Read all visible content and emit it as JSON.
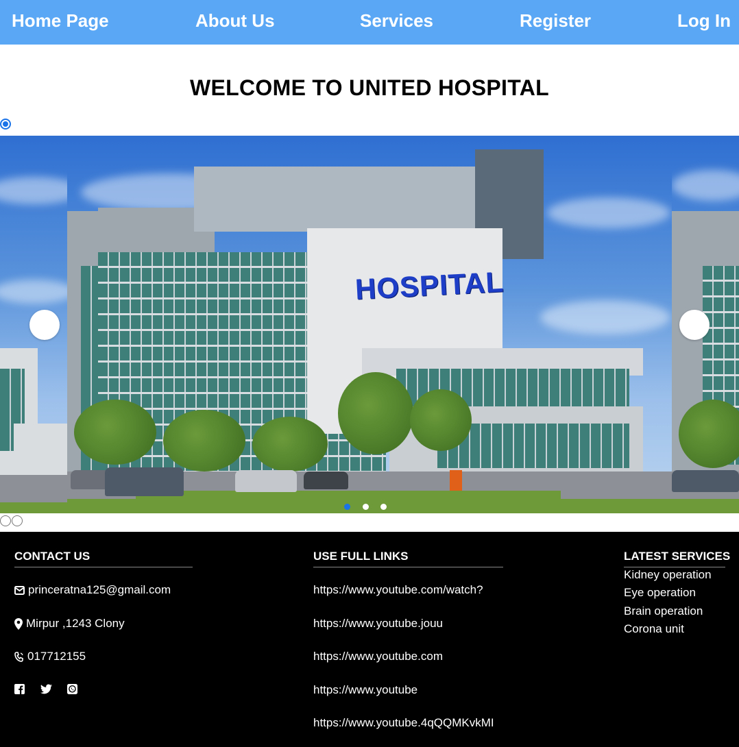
{
  "nav": {
    "items": [
      "Home Page",
      "About Us",
      "Services",
      "Register",
      "Log In"
    ]
  },
  "welcome_title": "WELCOME TO UNITED HOSPITAL",
  "slider": {
    "sign_text": "HOSPITAL",
    "slide_count": 3,
    "active_slide": 1
  },
  "footer": {
    "contact": {
      "heading": "CONTACT US",
      "email": "princeratna125@gmail.com",
      "address": "Mirpur ,1243 Clony",
      "phone": "017712155",
      "social": [
        "facebook-icon",
        "twitter-icon",
        "whatsapp-icon"
      ]
    },
    "links": {
      "heading": "USE FULL LINKS",
      "items": [
        "https://www.youtube.com/watch?",
        "https://www.youtube.jouu",
        "https://www.youtube.com",
        "https://www.youtube",
        "https://www.youtube.4qQQMKvkMI"
      ]
    },
    "services": {
      "heading": "LATEST SERVICES",
      "items": [
        "Kidney operation",
        "Eye operation",
        "Brain operation",
        "Corona unit"
      ]
    }
  },
  "colors": {
    "nav_bg": "#5aa8f5",
    "footer_bg": "#000000",
    "dot_active": "#1a73e8"
  }
}
